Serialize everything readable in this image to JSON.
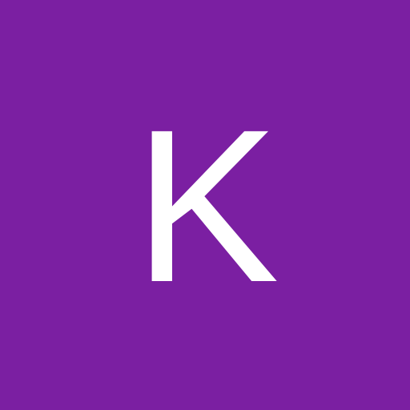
{
  "avatar": {
    "initial": "K",
    "background_color": "#7B1FA2",
    "text_color": "#FFFFFF"
  }
}
